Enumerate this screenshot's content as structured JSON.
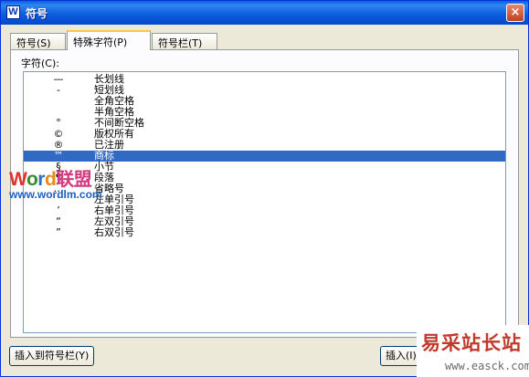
{
  "window": {
    "title": "符号",
    "app_icon": "W",
    "close_glyph": "×"
  },
  "tabs": [
    {
      "label": "符号(S)",
      "active": false
    },
    {
      "label": "特殊字符(P)",
      "active": true
    },
    {
      "label": "符号栏(T)",
      "active": false
    }
  ],
  "char_label": "字符(C):",
  "chars": [
    {
      "symbol": "—",
      "name": "长划线"
    },
    {
      "symbol": "-",
      "name": "短划线"
    },
    {
      "symbol": "",
      "name": "全角空格"
    },
    {
      "symbol": "",
      "name": "半角空格"
    },
    {
      "symbol": "°",
      "name": "不间断空格"
    },
    {
      "symbol": "©",
      "name": "版权所有"
    },
    {
      "symbol": "®",
      "name": "已注册"
    },
    {
      "symbol": "™",
      "name": "商标",
      "selected": true
    },
    {
      "symbol": "§",
      "name": "小节"
    },
    {
      "symbol": "¶",
      "name": "段落"
    },
    {
      "symbol": "…",
      "name": "省略号"
    },
    {
      "symbol": "‘",
      "name": "左单引号"
    },
    {
      "symbol": "’",
      "name": "右单引号"
    },
    {
      "symbol": "“",
      "name": "左双引号"
    },
    {
      "symbol": "”",
      "name": "右双引号"
    }
  ],
  "buttons": {
    "insert_to_bar": "插入到符号栏(Y)",
    "insert": "插入(I)"
  },
  "watermarks": {
    "left_word": [
      "W",
      "o",
      "r",
      "d"
    ],
    "left_cn": "联盟",
    "left_url": "www.wordlm.com",
    "right_cn": "易采站长站",
    "right_url": "www.easck.com"
  },
  "colors": {
    "title_bar": "#0a5fdd",
    "selection": "#316ac5",
    "active_tab_accent": "#ffc83c"
  }
}
